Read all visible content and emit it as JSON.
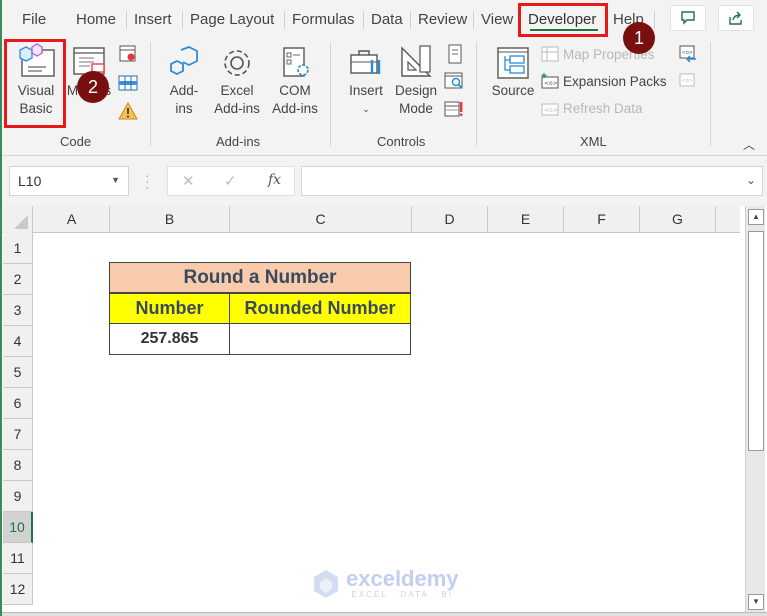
{
  "ribbon_tabs": [
    "File",
    "Home",
    "Insert",
    "Page Layout",
    "Formulas",
    "Data",
    "Review",
    "View",
    "Developer",
    "Help"
  ],
  "active_tab": "Developer",
  "annotations": {
    "badge_1": "1",
    "badge_2": "2"
  },
  "groups": {
    "code": {
      "label": "Code",
      "visual_basic": "Visual Basic",
      "macros": "Macros"
    },
    "addins": {
      "label": "Add-ins",
      "addins": "Add-ins",
      "excel_addins": "Excel Add-ins",
      "com_addins": "COM Add-ins"
    },
    "controls": {
      "label": "Controls",
      "insert": "Insert",
      "design_mode": "Design Mode"
    },
    "xml": {
      "label": "XML",
      "source": "Source",
      "map_properties": "Map Properties",
      "expansion_packs": "Expansion Packs",
      "refresh_data": "Refresh Data"
    }
  },
  "formula_bar": {
    "name_box": "L10",
    "cancel": "✕",
    "enter": "✓",
    "fx": "fx",
    "formula": ""
  },
  "columns": [
    "A",
    "B",
    "C",
    "D",
    "E",
    "F",
    "G"
  ],
  "rows": [
    "1",
    "2",
    "3",
    "4",
    "5",
    "6",
    "7",
    "8",
    "9",
    "10",
    "11",
    "12"
  ],
  "selected_row": "10",
  "table": {
    "title": "Round a Number",
    "headers": [
      "Number",
      "Rounded Number"
    ],
    "values": [
      "257.865",
      ""
    ]
  },
  "watermark": {
    "name": "exceldemy",
    "tagline": "EXCEL · DATA · BI"
  },
  "colors": {
    "highlight": "#e8191b",
    "badge": "#7a0f0f",
    "title_fill": "#f8cbad",
    "header_fill": "#ffff00",
    "excel_green": "#217346"
  }
}
